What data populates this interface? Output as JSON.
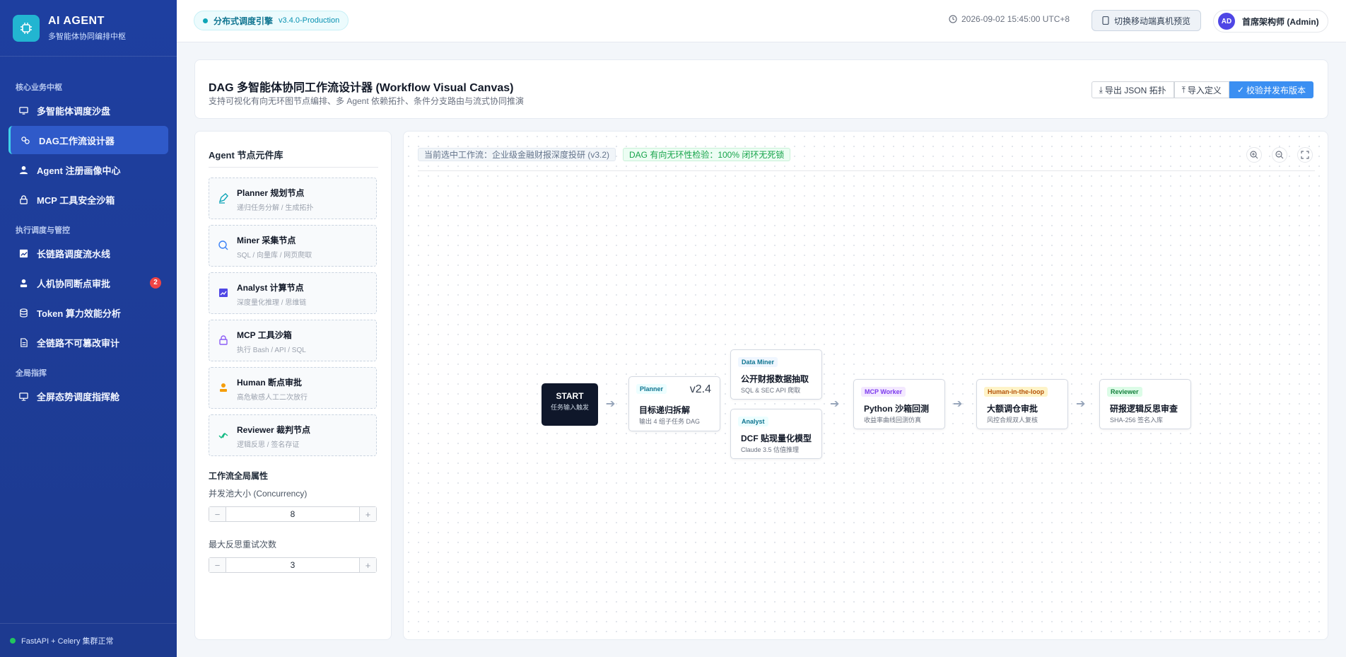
{
  "brand": {
    "title": "AI AGENT",
    "subtitle": "多智能体协同编排中枢"
  },
  "sidebar": {
    "groups": [
      {
        "label": "核心业务中枢",
        "items": [
          {
            "label": "多智能体调度沙盘",
            "icon": "monitor-icon"
          },
          {
            "label": "DAG工作流设计器",
            "icon": "flow-icon",
            "active": true
          },
          {
            "label": "Agent 注册画像中心",
            "icon": "user-icon"
          },
          {
            "label": "MCP 工具安全沙箱",
            "icon": "lock-icon"
          }
        ]
      },
      {
        "label": "执行调度与管控",
        "items": [
          {
            "label": "长链路调度流水线",
            "icon": "chart-icon"
          },
          {
            "label": "人机协同断点审批",
            "icon": "person-icon",
            "badge": "2"
          },
          {
            "label": "Token 算力效能分析",
            "icon": "database-icon"
          },
          {
            "label": "全链路不可篡改审计",
            "icon": "document-icon"
          }
        ]
      },
      {
        "label": "全局指挥",
        "items": [
          {
            "label": "全屏态势调度指挥舱",
            "icon": "screen-icon"
          }
        ]
      }
    ],
    "footer": "FastAPI + Celery 集群正常"
  },
  "topbar": {
    "engine_label": "分布式调度引擎",
    "engine_version": "v3.4.0-Production",
    "time": "2026-09-02 15:45:00 UTC+8",
    "mobile_button": "切换移动端真机预览",
    "avatar": "AD",
    "user": "首席架构师 (Admin)"
  },
  "header": {
    "title": "DAG 多智能体协同工作流设计器 (Workflow Visual Canvas)",
    "subtitle": "支持可视化有向无环图节点编排、多 Agent 依赖拓扑、条件分支路由与流式协同推演",
    "export_button": "导出 JSON 拓扑",
    "import_button": "导入定义",
    "publish_button": "校验并发布版本"
  },
  "library": {
    "title": "Agent 节点元件库",
    "items": [
      {
        "name": "Planner 规划节点",
        "desc": "递归任务分解 / 生成拓扑",
        "icon": "pen-icon",
        "color": "#0ea5b7"
      },
      {
        "name": "Miner 采集节点",
        "desc": "SQL / 向量库 / 网页爬取",
        "icon": "search-icon",
        "color": "#3b82f6"
      },
      {
        "name": "Analyst 计算节点",
        "desc": "深度量化推理 / 思维链",
        "icon": "chart-icon",
        "color": "#4f46e5"
      },
      {
        "name": "MCP 工具沙箱",
        "desc": "执行 Bash / API / SQL",
        "icon": "lock-icon",
        "color": "#8b5cf6"
      },
      {
        "name": "Human 断点审批",
        "desc": "高危敏感人工二次放行",
        "icon": "person-icon",
        "color": "#f59e0b"
      },
      {
        "name": "Reviewer 裁判节点",
        "desc": "逻辑反思 / 签名存证",
        "icon": "check-icon",
        "color": "#10b981"
      }
    ],
    "props_title": "工作流全局属性",
    "concurrency_label": "并发池大小 (Concurrency)",
    "concurrency_value": "8",
    "retry_label": "最大反思重试次数",
    "retry_value": "3",
    "minus": "−",
    "plus": "+"
  },
  "canvas": {
    "current_workflow": "当前选中工作流：企业级金融财报深度投研 (v3.2)",
    "dag_check": "DAG 有向无环性检验：100% 闭环无死锁",
    "start": {
      "title": "START",
      "subtitle": "任务输入触发"
    },
    "nodes": [
      {
        "tag": "Planner",
        "version": "v2.4",
        "title": "目标递归拆解",
        "desc": "输出 4 组子任务 DAG"
      },
      {
        "tag": "Data Miner",
        "title": "公开财报数据抽取",
        "desc": "SQL & SEC API 爬取"
      },
      {
        "tag": "Analyst",
        "title": "DCF 贴现量化模型",
        "desc": "Claude 3.5 估值推理"
      },
      {
        "tag": "MCP Worker",
        "title": "Python 沙箱回测",
        "desc": "收益率曲线回测仿真"
      },
      {
        "tag": "Human-in-the-loop",
        "title": "大额调仓审批",
        "desc": "风控合规双人复核"
      },
      {
        "tag": "Reviewer",
        "title": "研报逻辑反思审查",
        "desc": "SHA-256 签名入库"
      }
    ],
    "arrow": "➔"
  }
}
